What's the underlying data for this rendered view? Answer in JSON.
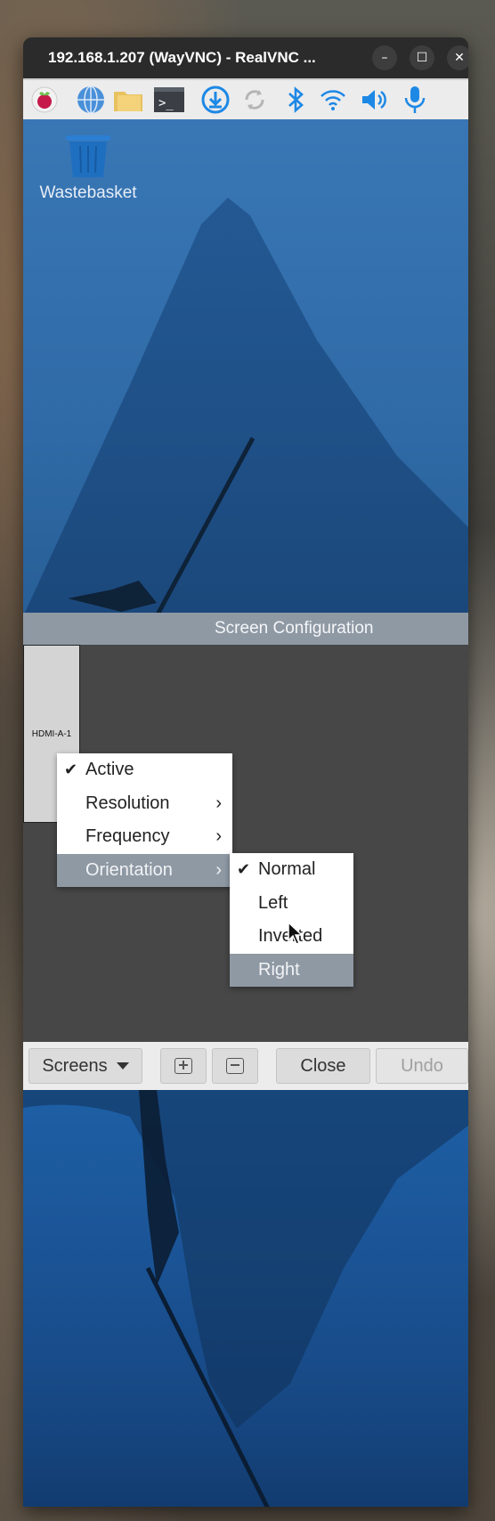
{
  "window": {
    "title": "192.168.1.207 (WayVNC) - RealVNC ...",
    "minimize_glyph": "–",
    "maximize_glyph": "☐",
    "close_glyph": "✕"
  },
  "taskbar": {
    "icons": [
      "raspberry-menu-icon",
      "web-browser-icon",
      "file-manager-icon",
      "terminal-icon",
      "updater-icon",
      "sync-icon",
      "bluetooth-icon",
      "wifi-icon",
      "volume-icon",
      "microphone-icon"
    ],
    "terminal_glyph": ">_"
  },
  "desktop": {
    "wastebasket_label": "Wastebasket"
  },
  "dialog": {
    "title": "Screen Configuration",
    "monitor_label": "HDMI-A-1",
    "bottom": {
      "screens_label": "Screens",
      "close_label": "Close",
      "undo_label": "Undo"
    }
  },
  "context_menu": {
    "items": [
      {
        "label": "Active",
        "checked": true,
        "submenu": false
      },
      {
        "label": "Resolution",
        "checked": false,
        "submenu": true
      },
      {
        "label": "Frequency",
        "checked": false,
        "submenu": true
      },
      {
        "label": "Orientation",
        "checked": false,
        "submenu": true,
        "highlighted": true
      }
    ]
  },
  "orientation_menu": {
    "items": [
      {
        "label": "Normal",
        "checked": true
      },
      {
        "label": "Left",
        "checked": false
      },
      {
        "label": "Inverted",
        "checked": false
      },
      {
        "label": "Right",
        "checked": false,
        "highlighted": true
      }
    ]
  },
  "colors": {
    "highlight": "#8f99a4",
    "dialog_bg": "#474747",
    "accent_blue": "#1e88e5"
  }
}
